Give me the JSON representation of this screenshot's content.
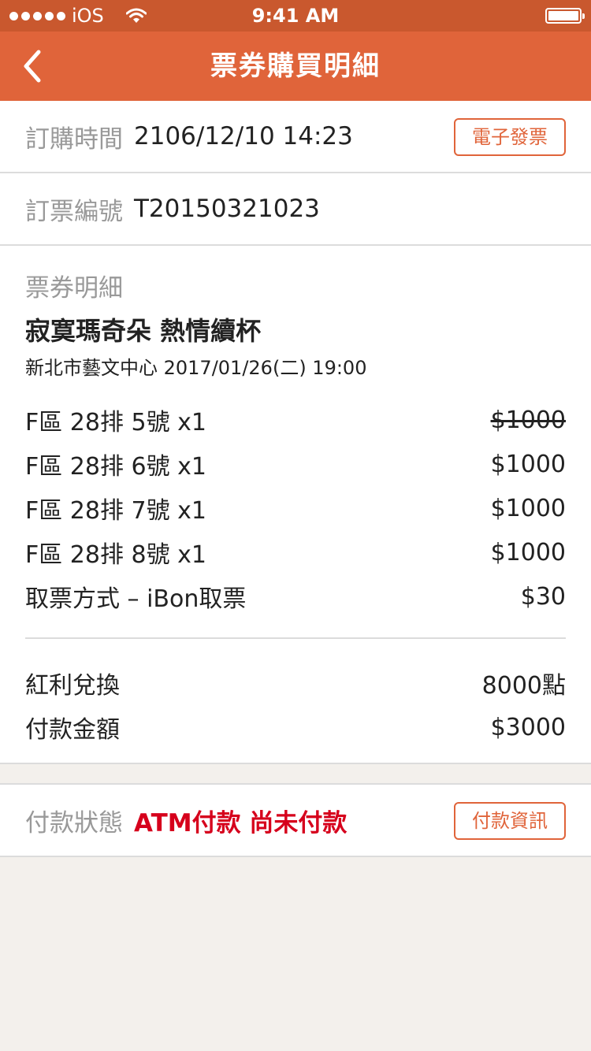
{
  "status_bar": {
    "carrier": "iOS",
    "time": "9:41 AM"
  },
  "nav": {
    "title": "票券購買明細",
    "back_icon": "chevron-left-icon"
  },
  "order": {
    "time_label": "訂購時間",
    "time_value": "2106/12/10 14:23",
    "invoice_button": "電子發票",
    "number_label": "訂票編號",
    "number_value": "T20150321023"
  },
  "details": {
    "section_title": "票券明細",
    "event_name": "寂寞瑪奇朵  熱情續杯",
    "venue_time": "新北市藝文中心   2017/01/26(二) 19:00",
    "lines": [
      {
        "label": "F區  28排  5號    x1",
        "price": "$1000",
        "struck": true
      },
      {
        "label": "F區  28排  6號    x1",
        "price": "$1000",
        "struck": false
      },
      {
        "label": "F區  28排  7號    x1",
        "price": "$1000",
        "struck": false
      },
      {
        "label": "F區  28排  8號    x1",
        "price": "$1000",
        "struck": false
      },
      {
        "label": "取票方式 – iBon取票",
        "price": "$30",
        "struck": false
      }
    ],
    "bonus_label": "紅利兌換",
    "bonus_value": "8000點",
    "amount_label": "付款金額",
    "amount_value": "$3000"
  },
  "payment": {
    "status_label": "付款狀態",
    "status_value": "ATM付款  尚未付款",
    "info_button": "付款資訊"
  },
  "colors": {
    "nav": "#e0643a",
    "status_bar": "#c9582e",
    "accent": "#e0643a",
    "alert": "#d6001c"
  }
}
